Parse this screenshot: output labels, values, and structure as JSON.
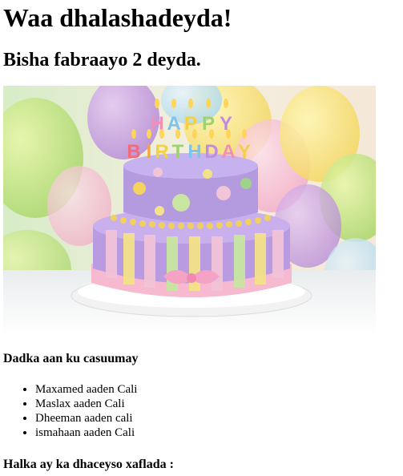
{
  "page": {
    "title": "Waa dhalashadeyda!",
    "subtitle": "Bisha fabraayo 2 deyda."
  },
  "hero_image": {
    "cake_text": "HAPPY BIRTHDAY"
  },
  "guests": {
    "heading": "Dadka aan ku casuumay",
    "items": [
      "Maxamed aaden Cali",
      "Maslax aaden Cali",
      "Dheeman aaden cali",
      "ismahaan aaden Cali"
    ]
  },
  "contact": {
    "heading": "Halka ay ka dhaceyso xaflada :"
  }
}
